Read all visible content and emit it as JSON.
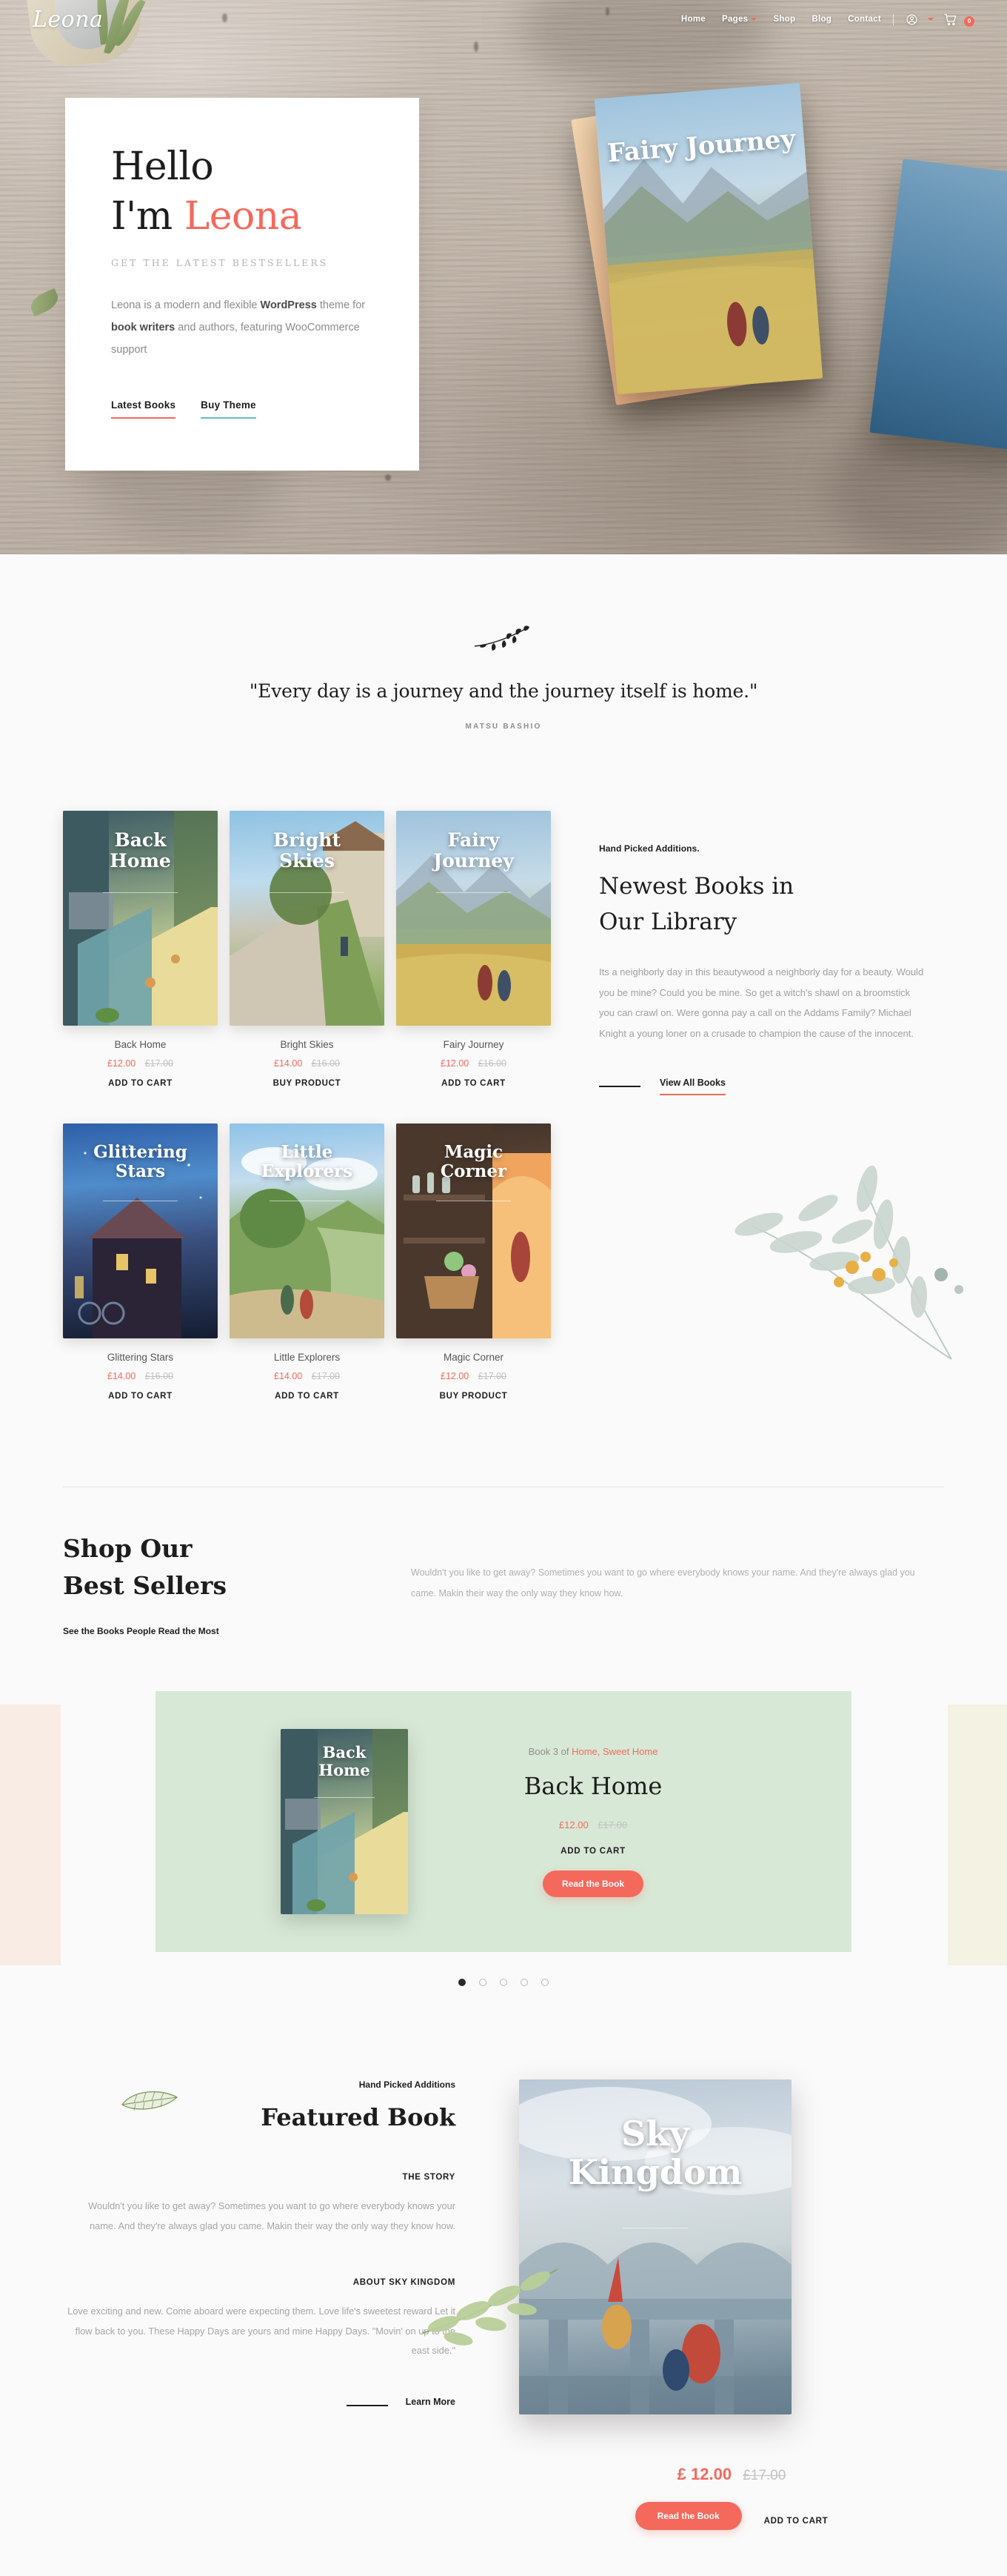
{
  "header": {
    "brand": "Leona",
    "nav": [
      {
        "label": "Home",
        "dropdown": false
      },
      {
        "label": "Pages",
        "dropdown": true
      },
      {
        "label": "Shop",
        "dropdown": false
      },
      {
        "label": "Blog",
        "dropdown": false
      },
      {
        "label": "Contact",
        "dropdown": false
      }
    ],
    "account_icon": "user-circle-icon",
    "cart_icon": "cart-icon",
    "cart_count": "0"
  },
  "hero": {
    "greeting": "Hello",
    "line2_prefix": "I'm ",
    "line2_accent": "Leona",
    "subtitle": "GET THE LATEST BESTSELLERS",
    "body_1": "Leona is a modern and flexible ",
    "body_bold_1": "WordPress",
    "body_2": " theme for ",
    "body_bold_2": "book writers",
    "body_3": " and authors, featuring WooCommerce support",
    "cta_primary": "Latest Books",
    "cta_secondary": "Buy Theme",
    "book_title": "Fairy Journey"
  },
  "quote": {
    "text": "\"Every day is a journey and the journey itself is home.\"",
    "author": "MATSU BASHIO"
  },
  "library": {
    "eyebrow": "Hand Picked Additions.",
    "heading_line1": "Newest Books in",
    "heading_line2": "Our Library",
    "body": "Its a neighborly day in this beautywood a neighborly day for a beauty. Would you be mine? Could you be mine. So get a witch's shawl on a broomstick you can crawl on. Were gonna pay a call on the Addams Family? Michael Knight a young loner on a crusade to champion the cause of the innocent.",
    "view_all": "View All Books",
    "books": [
      {
        "title": "Back Home",
        "cover_line1": "Back",
        "cover_line2": "Home",
        "price": "£12.00",
        "old_price": "£17.00",
        "cta": "ADD TO CART",
        "art": "art-back"
      },
      {
        "title": "Bright Skies",
        "cover_line1": "Bright",
        "cover_line2": "Skies",
        "price": "£14.00",
        "old_price": "£16.00",
        "cta": "BUY PRODUCT",
        "art": "art-bright"
      },
      {
        "title": "Fairy Journey",
        "cover_line1": "Fairy",
        "cover_line2": "Journey",
        "price": "£12.00",
        "old_price": "£16.00",
        "cta": "ADD TO CART",
        "art": "art-fairy"
      },
      {
        "title": "Glittering Stars",
        "cover_line1": "Glittering",
        "cover_line2": "Stars",
        "price": "£14.00",
        "old_price": "£16.00",
        "cta": "ADD TO CART",
        "art": "art-glitter"
      },
      {
        "title": "Little Explorers",
        "cover_line1": "Little",
        "cover_line2": "Explorers",
        "price": "£14.00",
        "old_price": "£17.00",
        "cta": "ADD TO CART",
        "art": "art-little"
      },
      {
        "title": "Magic Corner",
        "cover_line1": "Magic",
        "cover_line2": "Corner",
        "price": "£12.00",
        "old_price": "£17.00",
        "cta": "BUY PRODUCT",
        "art": "art-magic"
      }
    ]
  },
  "bestsellers": {
    "title_line1": "Shop Our",
    "title_line2": "Best Sellers",
    "note": "See the Books People Read the Most",
    "paragraph": "Wouldn't you like to get away? Sometimes you want to go where everybody knows your name. And they're always glad you came. Makin their way the only way they know how.",
    "slide": {
      "series_prefix": "Book 3 of ",
      "series_name": "Home, Sweet Home",
      "title": "Back Home",
      "cover_line1": "Back",
      "cover_line2": "Home",
      "price": "£12.00",
      "old_price": "£17.00",
      "cart_label": "ADD TO CART",
      "read_label": "Read the Book"
    },
    "dots_total": 5,
    "dots_active_index": 0
  },
  "featured": {
    "eyebrow": "Hand Picked Additions",
    "title": "Featured Book",
    "story_label": "THE STORY",
    "story_text": "Wouldn't you like to get away? Sometimes you want to go where everybody knows your name. And they're always glad you came. Makin their way the only way they know how.",
    "about_label": "ABOUT SKY KINGDOM",
    "about_text": "Love exciting and new. Come aboard were expecting them. Love life's sweetest reward Let it flow back to you. These Happy Days are yours and mine Happy Days. \"Movin' on up to the east side.\"",
    "learn_more": "Learn More",
    "cover_line1": "Sky",
    "cover_line2": "Kingdom",
    "price": "£ 12.00",
    "old_price": "£17.00",
    "read_label": "Read the Book",
    "cart_label": "ADD TO CART"
  },
  "colors": {
    "accent": "#f4695c",
    "teal": "#64c0c4",
    "slide_bg": "#d8e8d6",
    "band_left": "#f8ece5",
    "band_right": "#f3f2e3",
    "muted": "#a0a0a0"
  }
}
